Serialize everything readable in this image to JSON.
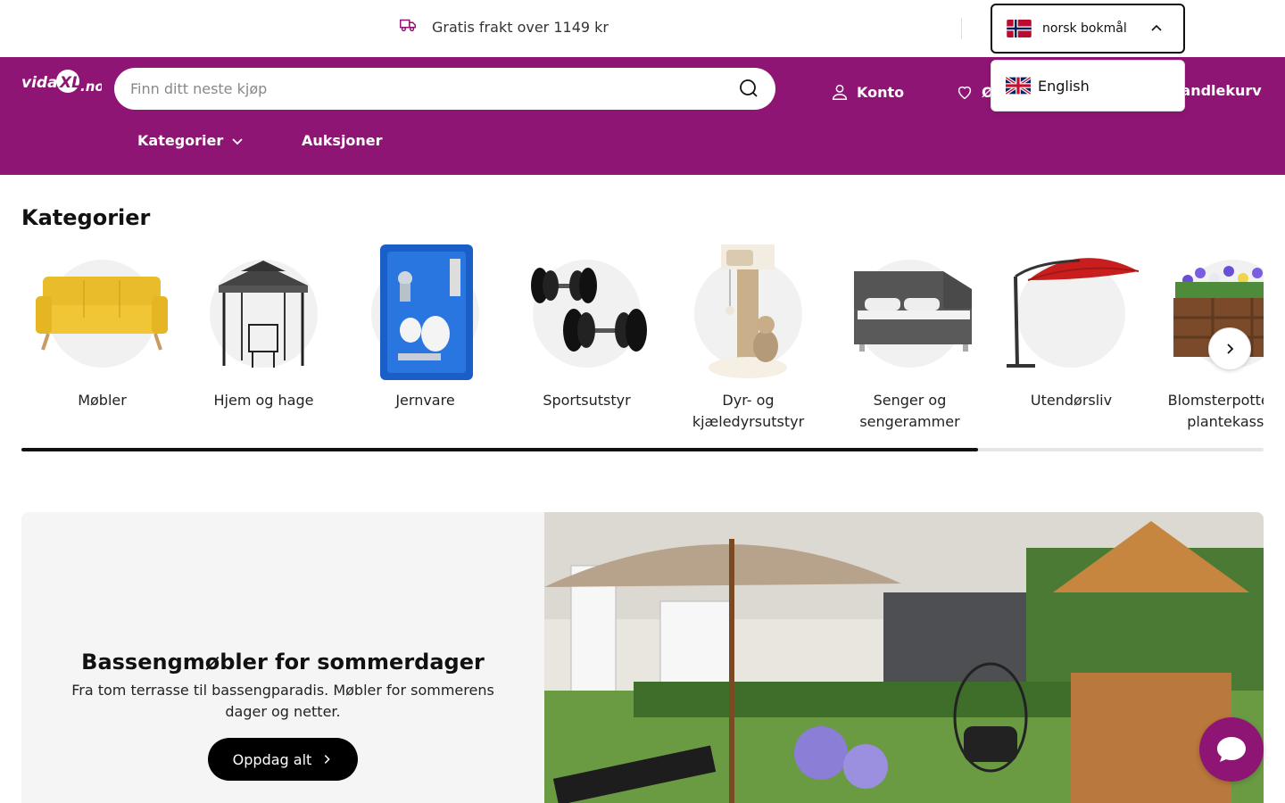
{
  "topbar": {
    "freight_text": "Gratis frakt over 1149 kr",
    "language_selected": "norsk bokmål",
    "language_options": [
      "English"
    ]
  },
  "header": {
    "logo_text": "vidaXL.no",
    "search_placeholder": "Finn ditt neste kjøp",
    "account_label": "Konto",
    "wishlist_label": "Ø",
    "cart_label": "Handlekurv",
    "nav": {
      "categories_label": "Kategorier",
      "auctions_label": "Auksjoner"
    }
  },
  "categories": {
    "title": "Kategorier",
    "items": [
      {
        "label": "Møbler"
      },
      {
        "label": "Hjem og hage"
      },
      {
        "label": "Jernvare"
      },
      {
        "label": "Sportsutstyr"
      },
      {
        "label": "Dyr- og kjæledyrsutstyr"
      },
      {
        "label": "Senger og sengerammer"
      },
      {
        "label": "Utendørsliv"
      },
      {
        "label": "Blomsterpotter og plantekasser"
      }
    ],
    "scroll_progress": 0.77
  },
  "banner": {
    "title": "Bassengmøbler for sommerdager",
    "subtitle": "Fra tom terrasse til bassengparadis. Møbler for sommerens dager og netter.",
    "button_label": "Oppdag alt"
  },
  "colors": {
    "brand": "#8f1574",
    "text": "#111111"
  }
}
